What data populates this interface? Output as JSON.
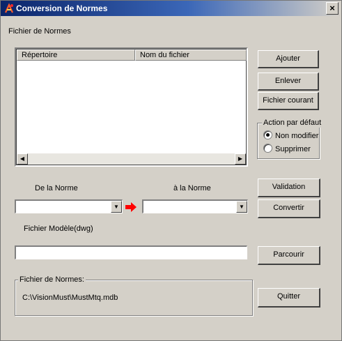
{
  "window": {
    "title": "Conversion de Normes",
    "close_label": "×"
  },
  "section_label": "Fichier de Normes",
  "list": {
    "columns": [
      "Répertoire",
      "Nom du fichier"
    ],
    "rows": []
  },
  "buttons": {
    "add": "Ajouter",
    "remove": "Enlever",
    "current_file": "Fichier courant",
    "validation": "Validation",
    "convert": "Convertir",
    "browse": "Parcourir",
    "quit": "Quitter"
  },
  "default_action": {
    "legend": "Action par défaut",
    "options": [
      "Non modifier",
      "Supprimer"
    ],
    "selected": "Non modifier"
  },
  "conversion": {
    "from_label": "De la Norme",
    "to_label": "à la Norme",
    "from_value": "",
    "to_value": ""
  },
  "model_file": {
    "label": "Fichier Modèle(dwg)",
    "value": ""
  },
  "norms_file": {
    "legend": "Fichier de Normes:",
    "path": "C:\\VisionMust\\MustMtq.mdb"
  },
  "colors": {
    "titlebar_start": "#0a246a",
    "titlebar_end": "#d4d0c8",
    "dialog_bg": "#d4d0c8",
    "arrow_red": "#ff0000"
  },
  "icons": {
    "title": "app-icon",
    "close": "close-icon",
    "scroll_left": "scroll-left-arrow-icon",
    "scroll_right": "scroll-right-arrow-icon",
    "dropdown": "dropdown-arrow-icon",
    "convert_arrow": "red-right-arrow-icon"
  }
}
